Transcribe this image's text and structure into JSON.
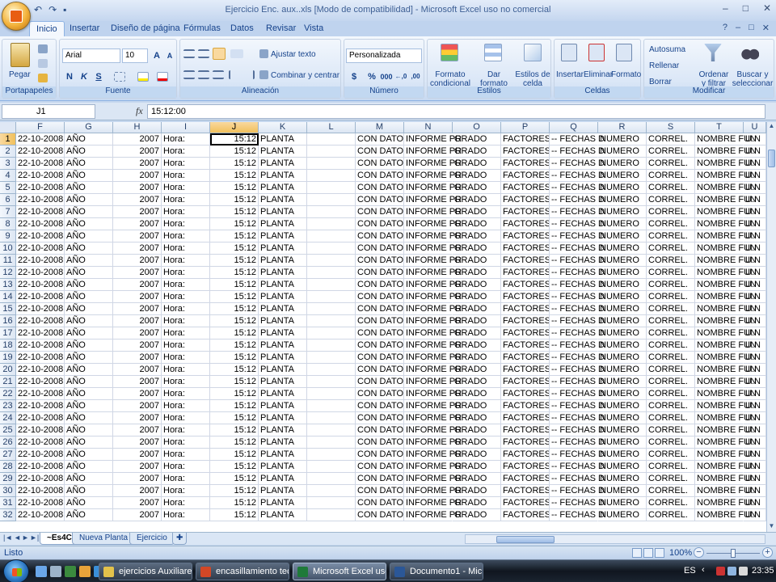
{
  "window": {
    "title": "Ejercicio Enc. aux..xls  [Modo de compatibilidad] - Microsoft Excel uso no comercial",
    "controls": [
      "–",
      "□",
      "✕"
    ]
  },
  "qat": [
    "↶",
    "↷",
    "▪"
  ],
  "tabs": [
    "Inicio",
    "Insertar",
    "Diseño de página",
    "Fórmulas",
    "Datos",
    "Revisar",
    "Vista"
  ],
  "help_controls": [
    "?",
    "–",
    "□",
    "✕"
  ],
  "ribbon": {
    "clipboard": {
      "label": "Portapapeles",
      "paste": "Pegar"
    },
    "font": {
      "label": "Fuente",
      "name": "Arial",
      "size": "10",
      "grow": "A",
      "shrink": "A",
      "bold": "N",
      "italic": "K",
      "underline": "S"
    },
    "alignment": {
      "label": "Alineación",
      "wrap": "Ajustar texto",
      "merge": "Combinar y centrar"
    },
    "number": {
      "label": "Número",
      "format": "Personalizada",
      "currency": "$",
      "percent": "%",
      "thousands": "000",
      "inc_decimal": "←,0",
      "dec_decimal": ",00"
    },
    "styles": {
      "label": "Estilos",
      "conditional": "Formato condicional",
      "table": "Dar formato como tabla",
      "cell_styles": "Estilos de celda"
    },
    "cells": {
      "label": "Celdas",
      "insert": "Insertar",
      "delete": "Eliminar",
      "format": "Formato"
    },
    "edit": {
      "label": "Modificar",
      "autosum": "Autosuma",
      "fill": "Rellenar",
      "clear": "Borrar",
      "sort": "Ordenar y filtrar",
      "find": "Buscar y seleccionar"
    }
  },
  "formula_bar": {
    "cell_ref": "J1",
    "fx": "fx",
    "value": "15:12:00"
  },
  "columns": [
    "F",
    "G",
    "H",
    "I",
    "J",
    "K",
    "L",
    "M",
    "N",
    "O",
    "P",
    "Q",
    "R",
    "S",
    "T",
    "U"
  ],
  "row_template": [
    "22-10-2008",
    "AÑO",
    "2007",
    "Hora:",
    "15:12",
    "PLANTA",
    "",
    "CON DATOS",
    "INFORME PR",
    "GRADO",
    "FACTORES",
    "-- FECHAS D",
    "NUMERO",
    "CORREL.",
    "NOMBRE FUN",
    "U.N"
  ],
  "row_count": 32,
  "sheets": [
    "~Es4C",
    "Nueva Planta",
    "Ejercicio"
  ],
  "status": {
    "text": "Listo",
    "zoom": "100%"
  },
  "taskbar": {
    "buttons": [
      "ejercicios Auxiliares",
      "encasillamiento tec...",
      "Microsoft Excel uso ...",
      "Documento1 - Micr..."
    ],
    "lang": "ES",
    "time": "23:35"
  },
  "colors": {
    "accent": "#15428b",
    "selection": "#f1c05c"
  }
}
